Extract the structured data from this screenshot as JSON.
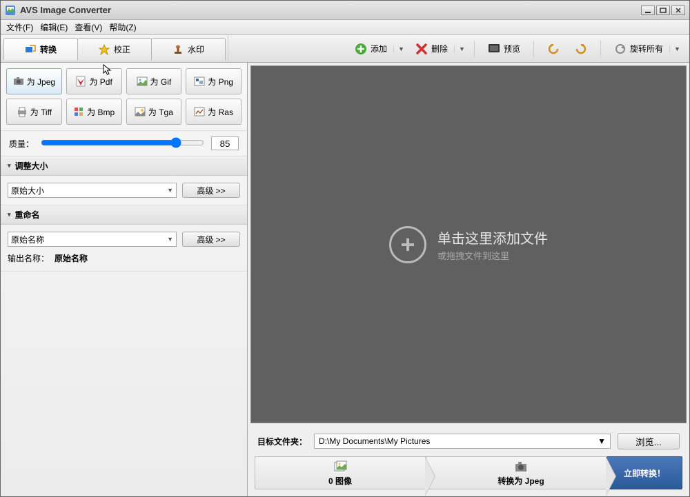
{
  "app": {
    "title": "AVS Image Converter"
  },
  "menu": {
    "file": "文件(F)",
    "edit": "编辑(E)",
    "view": "查看(V)",
    "help": "帮助(Z)"
  },
  "tabs": {
    "convert": "转换",
    "correct": "校正",
    "watermark": "水印"
  },
  "toolbar": {
    "add": "添加",
    "remove": "删除",
    "preview": "预览",
    "rotate": "旋转所有"
  },
  "formats": {
    "jpeg": "为 Jpeg",
    "pdf": "为 Pdf",
    "gif": "为 Gif",
    "png": "为 Png",
    "tiff": "为 Tiff",
    "bmp": "为 Bmp",
    "tga": "为 Tga",
    "ras": "为 Ras"
  },
  "quality": {
    "label": "质量：",
    "value": "85"
  },
  "resize": {
    "header": "调整大小",
    "preset": "原始大小",
    "adv": "高级 >>"
  },
  "rename": {
    "header": "重命名",
    "preset": "原始名称",
    "adv": "高级 >>",
    "outlabel": "输出名称：",
    "outvalue": "原始名称"
  },
  "preview": {
    "line1": "单击这里添加文件",
    "line2": "或拖拽文件到这里"
  },
  "dest": {
    "label": "目标文件夹：",
    "path": "D:\\My Documents\\My Pictures",
    "browse": "浏览..."
  },
  "steps": {
    "images": "0 图像",
    "convertto": "转换为 Jpeg",
    "convertnow": "立即转换！"
  }
}
